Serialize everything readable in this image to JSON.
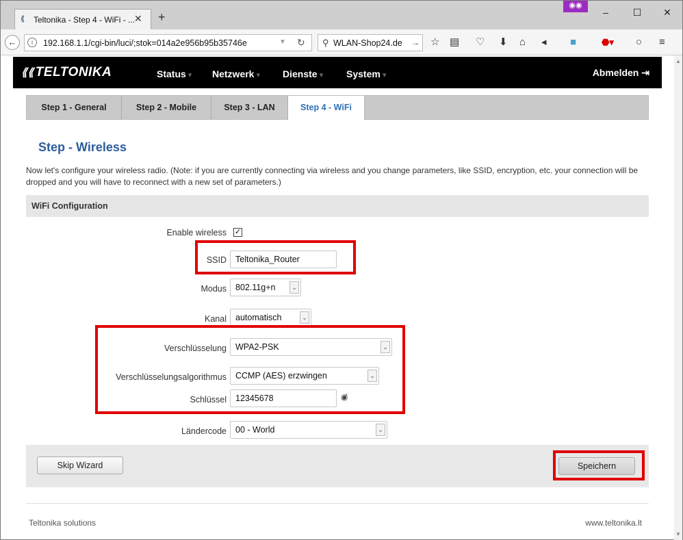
{
  "browser": {
    "tab_title": "Teltonika - Step 4 - WiFi - ...",
    "new_tab": "+",
    "private_mask": "⌨",
    "url": "192.168.1.1/cgi-bin/luci/;stok=014a2e956b95b35746e",
    "search_text": "WLAN-Shop24.de"
  },
  "router": {
    "logo": "TELTONIKA",
    "menu": [
      "Status",
      "Netzwerk",
      "Dienste",
      "System"
    ],
    "logout": "Abmelden"
  },
  "steps": [
    "Step 1 - General",
    "Step 2 - Mobile",
    "Step 3 - LAN",
    "Step 4 - WiFi"
  ],
  "page": {
    "title": "Step - Wireless",
    "description": "Now let's configure your wireless radio. (Note: if you are currently connecting via wireless and you change parameters, like SSID, encryption, etc. your connection will be dropped and you will have to reconnect with a new set of parameters.)",
    "section": "WiFi Configuration"
  },
  "form": {
    "enable_wireless_label": "Enable wireless",
    "ssid_label": "SSID",
    "ssid_value": "Teltonika_Router",
    "mode_label": "Modus",
    "mode_value": "802.11g+n",
    "channel_label": "Kanal",
    "channel_value": "automatisch",
    "encryption_label": "Verschlüsselung",
    "encryption_value": "WPA2-PSK",
    "algo_label": "Verschlüsselungsalgorithmus",
    "algo_value": "CCMP (AES) erzwingen",
    "key_label": "Schlüssel",
    "key_value": "12345678",
    "country_label": "Ländercode",
    "country_value": "00 - World"
  },
  "buttons": {
    "skip": "Skip Wizard",
    "save": "Speichern"
  },
  "footer": {
    "left": "Teltonika solutions",
    "right": "www.teltonika.lt"
  },
  "colors": {
    "highlight": "#e00000",
    "active_step": "#2f6fb3",
    "title": "#2b5d9c"
  }
}
